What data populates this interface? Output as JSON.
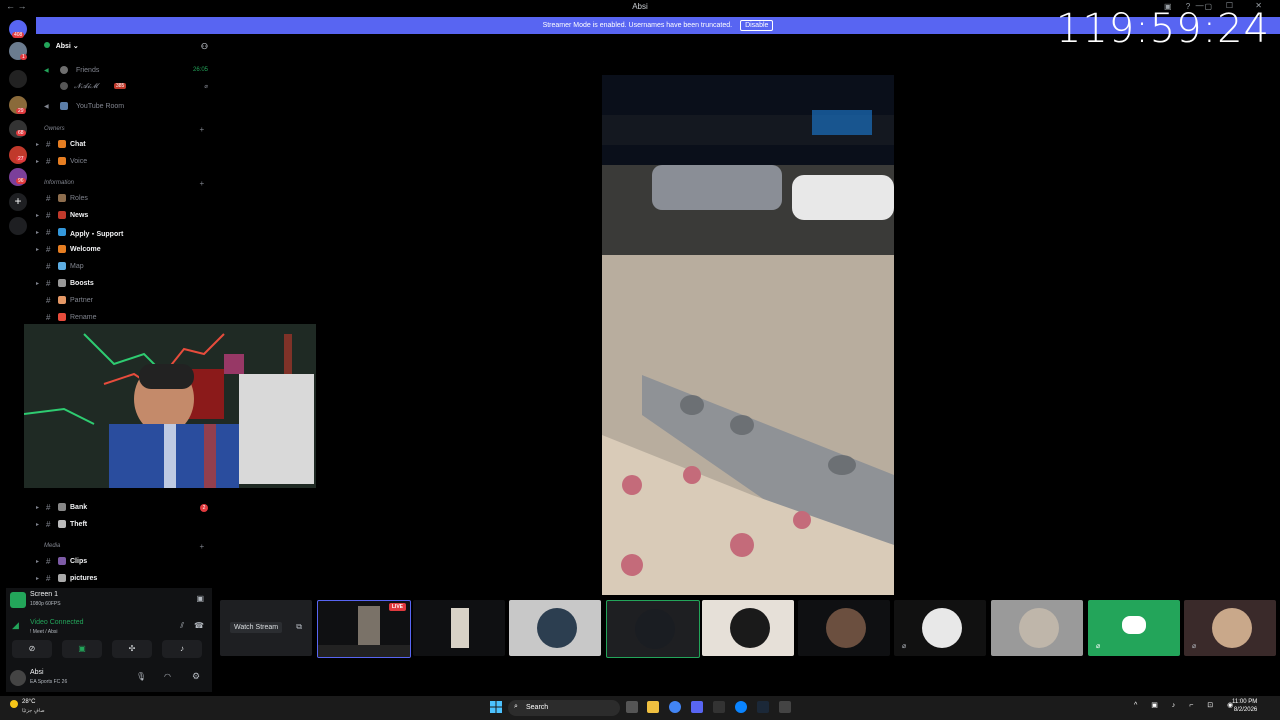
{
  "window": {
    "title": "Absi",
    "nav_icons": "← →",
    "controls": "— ☐ ✕",
    "title_icons": "▣ ? ▢"
  },
  "banner": {
    "text": "Streamer Mode is enabled. Usernames have been truncated.",
    "disable_label": "Disable"
  },
  "overlay_timer": "119:59:24",
  "rail": {
    "badges": [
      "408",
      "1",
      "29",
      "68",
      "27",
      "96"
    ]
  },
  "server": {
    "name": "Absi",
    "chevron": "⌄"
  },
  "channels": [
    {
      "type": "voice",
      "label": "Friends",
      "time": "26:05",
      "style": "dim"
    },
    {
      "type": "member",
      "label": "𝓝𝓐𝓲𝓜",
      "tag": "385",
      "style": "dim"
    },
    {
      "type": "voice",
      "label": "YouTube Room",
      "style": "dim"
    },
    {
      "type": "category",
      "label": "Owners"
    },
    {
      "type": "text",
      "label": "Chat",
      "style": "bold"
    },
    {
      "type": "text",
      "label": "Voice",
      "style": "dim"
    },
    {
      "type": "category",
      "label": "Information"
    },
    {
      "type": "text",
      "label": "Roles",
      "style": "dim"
    },
    {
      "type": "text",
      "label": "News",
      "style": "bold"
    },
    {
      "type": "text",
      "label": "Apply・Support",
      "style": "bold"
    },
    {
      "type": "text",
      "label": "Welcome",
      "style": "bold"
    },
    {
      "type": "text",
      "label": "Map",
      "style": "dim"
    },
    {
      "type": "text",
      "label": "Boosts",
      "style": "bold"
    },
    {
      "type": "text",
      "label": "Partner",
      "style": "dim"
    },
    {
      "type": "text",
      "label": "Rename",
      "style": "dim"
    }
  ],
  "channels_lower": [
    {
      "type": "text",
      "label": "Bank",
      "style": "bold",
      "badge": "2"
    },
    {
      "type": "text",
      "label": "Theft",
      "style": "bold"
    },
    {
      "type": "category",
      "label": "Media"
    },
    {
      "type": "text",
      "label": "Clips",
      "style": "bold"
    },
    {
      "type": "text",
      "label": "pictures",
      "style": "bold"
    }
  ],
  "screen_share": {
    "title": "Screen 1",
    "subtitle": "1080p 60FPS"
  },
  "voice": {
    "status": "Video Connected",
    "channel": "! Meet / Absi"
  },
  "user": {
    "name": "Absi",
    "activity": "EA Sports FC 26"
  },
  "tiles": {
    "watch_label": "Watch Stream",
    "live_label": "LIVE"
  },
  "taskbar": {
    "weather_temp": "28°C",
    "weather_desc": "صافٍ جزئيًا",
    "search_label": "Search",
    "time": "11:00 PM",
    "date": "8/2/2026"
  },
  "colors": {
    "blurple": "#5865f2",
    "online": "#23a55a",
    "danger": "#e03a3e"
  }
}
